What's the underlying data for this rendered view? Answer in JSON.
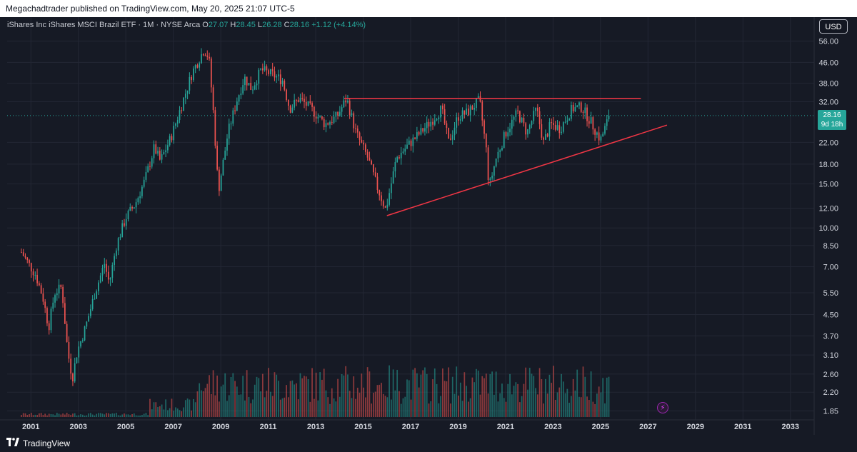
{
  "header": {
    "published_text": "Megachadtrader published on TradingView.com, May 20, 2025 21:07 UTC-5"
  },
  "symbol": {
    "name": "iShares Inc iShares MSCI Brazil ETF · 1M · NYSE Arca",
    "o_label": "O",
    "o_value": "27.07",
    "h_label": "H",
    "h_value": "28.45",
    "l_label": "L",
    "l_value": "26.28",
    "c_label": "C",
    "c_value": "28.16",
    "change": "+1.12 (+4.14%)"
  },
  "currency": "USD",
  "price_badge": {
    "price": "28.16",
    "countdown": "9d 18h"
  },
  "footer": {
    "logo_text": "TradingView"
  },
  "colors": {
    "up": "#26a69a",
    "down": "#ef5350",
    "background": "#161a25",
    "trendline": "#f23645",
    "grid": "#232734",
    "text": "#d1d4dc"
  },
  "icons": {
    "alert": "lightning-icon",
    "logo": "tradingview-logo-icon"
  },
  "chart_data": {
    "type": "candlestick",
    "interval": "1M",
    "y_scale": "log",
    "y_ticks": [
      56.0,
      46.0,
      38.0,
      32.0,
      28.16,
      22.0,
      18.0,
      15.0,
      12.0,
      10.0,
      8.5,
      7.0,
      5.5,
      4.5,
      3.7,
      3.1,
      2.6,
      2.2,
      1.85
    ],
    "y_tick_labels": [
      "56.00",
      "46.00",
      "38.00",
      "32.00",
      "22.00",
      "18.00",
      "15.00",
      "12.00",
      "10.00",
      "8.50",
      "7.00",
      "5.50",
      "4.50",
      "3.70",
      "3.10",
      "2.60",
      "2.20",
      "1.85"
    ],
    "x_tick_labels": [
      "2001",
      "2003",
      "2005",
      "2007",
      "2009",
      "2011",
      "2013",
      "2015",
      "2017",
      "2019",
      "2021",
      "2023",
      "2025",
      "2027",
      "2029",
      "2031",
      "2033"
    ],
    "ylim": [
      1.75,
      62
    ],
    "xlim": [
      2000.0,
      2034.0
    ],
    "last_close": 28.16,
    "anchors": [
      [
        2000.6,
        8.0
      ],
      [
        2000.9,
        7.2
      ],
      [
        2001.2,
        6.5
      ],
      [
        2001.5,
        5.3
      ],
      [
        2001.75,
        4.0
      ],
      [
        2002.0,
        5.5
      ],
      [
        2002.3,
        5.8
      ],
      [
        2002.55,
        3.2
      ],
      [
        2002.75,
        2.5
      ],
      [
        2002.95,
        3.2
      ],
      [
        2003.3,
        4.0
      ],
      [
        2003.7,
        5.5
      ],
      [
        2004.1,
        7.2
      ],
      [
        2004.3,
        6.0
      ],
      [
        2004.6,
        8.5
      ],
      [
        2005.0,
        11.0
      ],
      [
        2005.4,
        12.5
      ],
      [
        2005.8,
        15.5
      ],
      [
        2006.2,
        21.0
      ],
      [
        2006.45,
        18.5
      ],
      [
        2006.9,
        23.0
      ],
      [
        2007.3,
        30.0
      ],
      [
        2007.8,
        42.0
      ],
      [
        2008.3,
        52.0
      ],
      [
        2008.5,
        48.0
      ],
      [
        2008.7,
        28.0
      ],
      [
        2008.9,
        14.0
      ],
      [
        2009.3,
        24.0
      ],
      [
        2009.7,
        33.0
      ],
      [
        2010.0,
        40.0
      ],
      [
        2010.3,
        36.0
      ],
      [
        2010.7,
        43.0
      ],
      [
        2011.2,
        41.0
      ],
      [
        2011.6,
        39.0
      ],
      [
        2011.9,
        30.0
      ],
      [
        2012.3,
        33.0
      ],
      [
        2012.8,
        30.0
      ],
      [
        2013.4,
        26.0
      ],
      [
        2013.9,
        28.0
      ],
      [
        2014.3,
        33.0
      ],
      [
        2014.7,
        24.0
      ],
      [
        2015.2,
        19.0
      ],
      [
        2015.6,
        14.5
      ],
      [
        2015.95,
        11.8
      ],
      [
        2016.4,
        19.0
      ],
      [
        2016.9,
        21.5
      ],
      [
        2017.4,
        24.0
      ],
      [
        2017.9,
        27.0
      ],
      [
        2018.3,
        30.0
      ],
      [
        2018.6,
        22.0
      ],
      [
        2019.0,
        28.0
      ],
      [
        2019.4,
        29.0
      ],
      [
        2019.9,
        32.5
      ],
      [
        2020.2,
        20.0
      ],
      [
        2020.3,
        14.5
      ],
      [
        2020.6,
        19.0
      ],
      [
        2021.0,
        24.0
      ],
      [
        2021.5,
        29.0
      ],
      [
        2021.9,
        24.0
      ],
      [
        2022.3,
        30.0
      ],
      [
        2022.6,
        22.0
      ],
      [
        2022.9,
        26.0
      ],
      [
        2023.3,
        25.0
      ],
      [
        2023.8,
        30.0
      ],
      [
        2024.2,
        30.5
      ],
      [
        2024.6,
        26.5
      ],
      [
        2025.0,
        22.5
      ],
      [
        2025.38,
        28.16
      ]
    ],
    "trendlines": [
      {
        "name": "resistance",
        "points": [
          [
            2014.2,
            33.0
          ],
          [
            2026.7,
            33.0
          ]
        ]
      },
      {
        "name": "support",
        "points": [
          [
            2016.0,
            11.2
          ],
          [
            2027.8,
            25.8
          ]
        ]
      }
    ]
  }
}
